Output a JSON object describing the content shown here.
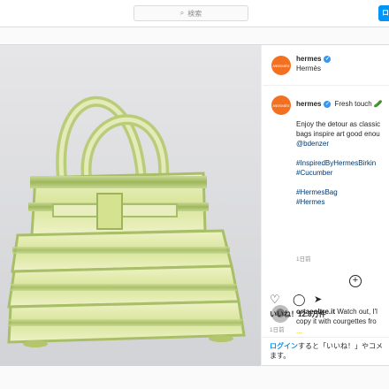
{
  "search": {
    "placeholder": "検索",
    "icon": "search-icon"
  },
  "topbar": {
    "button_label": "ロ"
  },
  "post": {
    "header": {
      "username": "hermes",
      "subtitle": "Hermès",
      "avatar_text": "HERMÈS"
    },
    "caption": {
      "username": "hermes",
      "title": "Fresh touch 🥒",
      "body_lines": [
        "Enjoy the detour as classic",
        "bags inspire art good enou"
      ],
      "mention": "@bdenzer",
      "hashtags_a": [
        "#InspiredByHermesBirkin",
        "#Cucumber"
      ],
      "hashtags_b": [
        "#HermesBag",
        "#Hermes"
      ],
      "time": "1日前"
    },
    "comment": {
      "username": "ortaeoltre.it",
      "lines": [
        "Watch out, I'l",
        "copy it with courgettes fro"
      ],
      "partial": "..."
    },
    "likes": "いいね！12.8万件",
    "time": "1日前",
    "login_prompt": {
      "link": "ログイン",
      "rest": "すると「いいね！」やコメ",
      "line2": "ます。"
    }
  },
  "colors": {
    "accent": "#0095f6",
    "brand_orange": "#f37021",
    "verified": "#3897f0"
  }
}
